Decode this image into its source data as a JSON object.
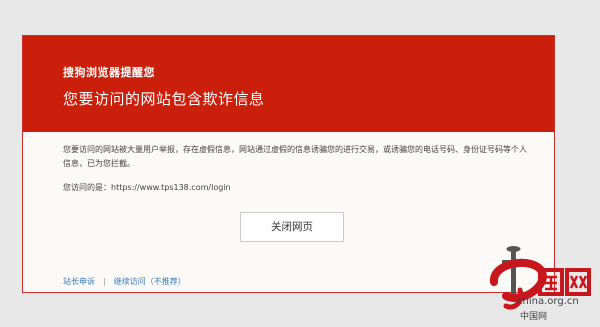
{
  "warning": {
    "brand": "搜狗浏览器提醒您",
    "headline": "您要访问的网站包含欺诈信息",
    "body": "您要访问的网站被大量用户举报，存在虚假信息，网站通过虚假的信息诱骗您的进行交易，或诱骗您的电话号码、身份证号码等个人信息，已为您拦截。",
    "url_label": "您访问的是：",
    "url": "https://www.tps138.com/login",
    "close_label": "关闭网页",
    "report_link": "站长申诉",
    "separator": "|",
    "continue_link": "继续访问（不推荐）"
  },
  "watermark": {
    "site": "china.org.cn",
    "site_cn": "中国网",
    "red": "#c8161d"
  },
  "colors": {
    "header_bg": "#c91f0b",
    "card_bg": "#fbfaf7",
    "link": "#3a7bbf"
  }
}
